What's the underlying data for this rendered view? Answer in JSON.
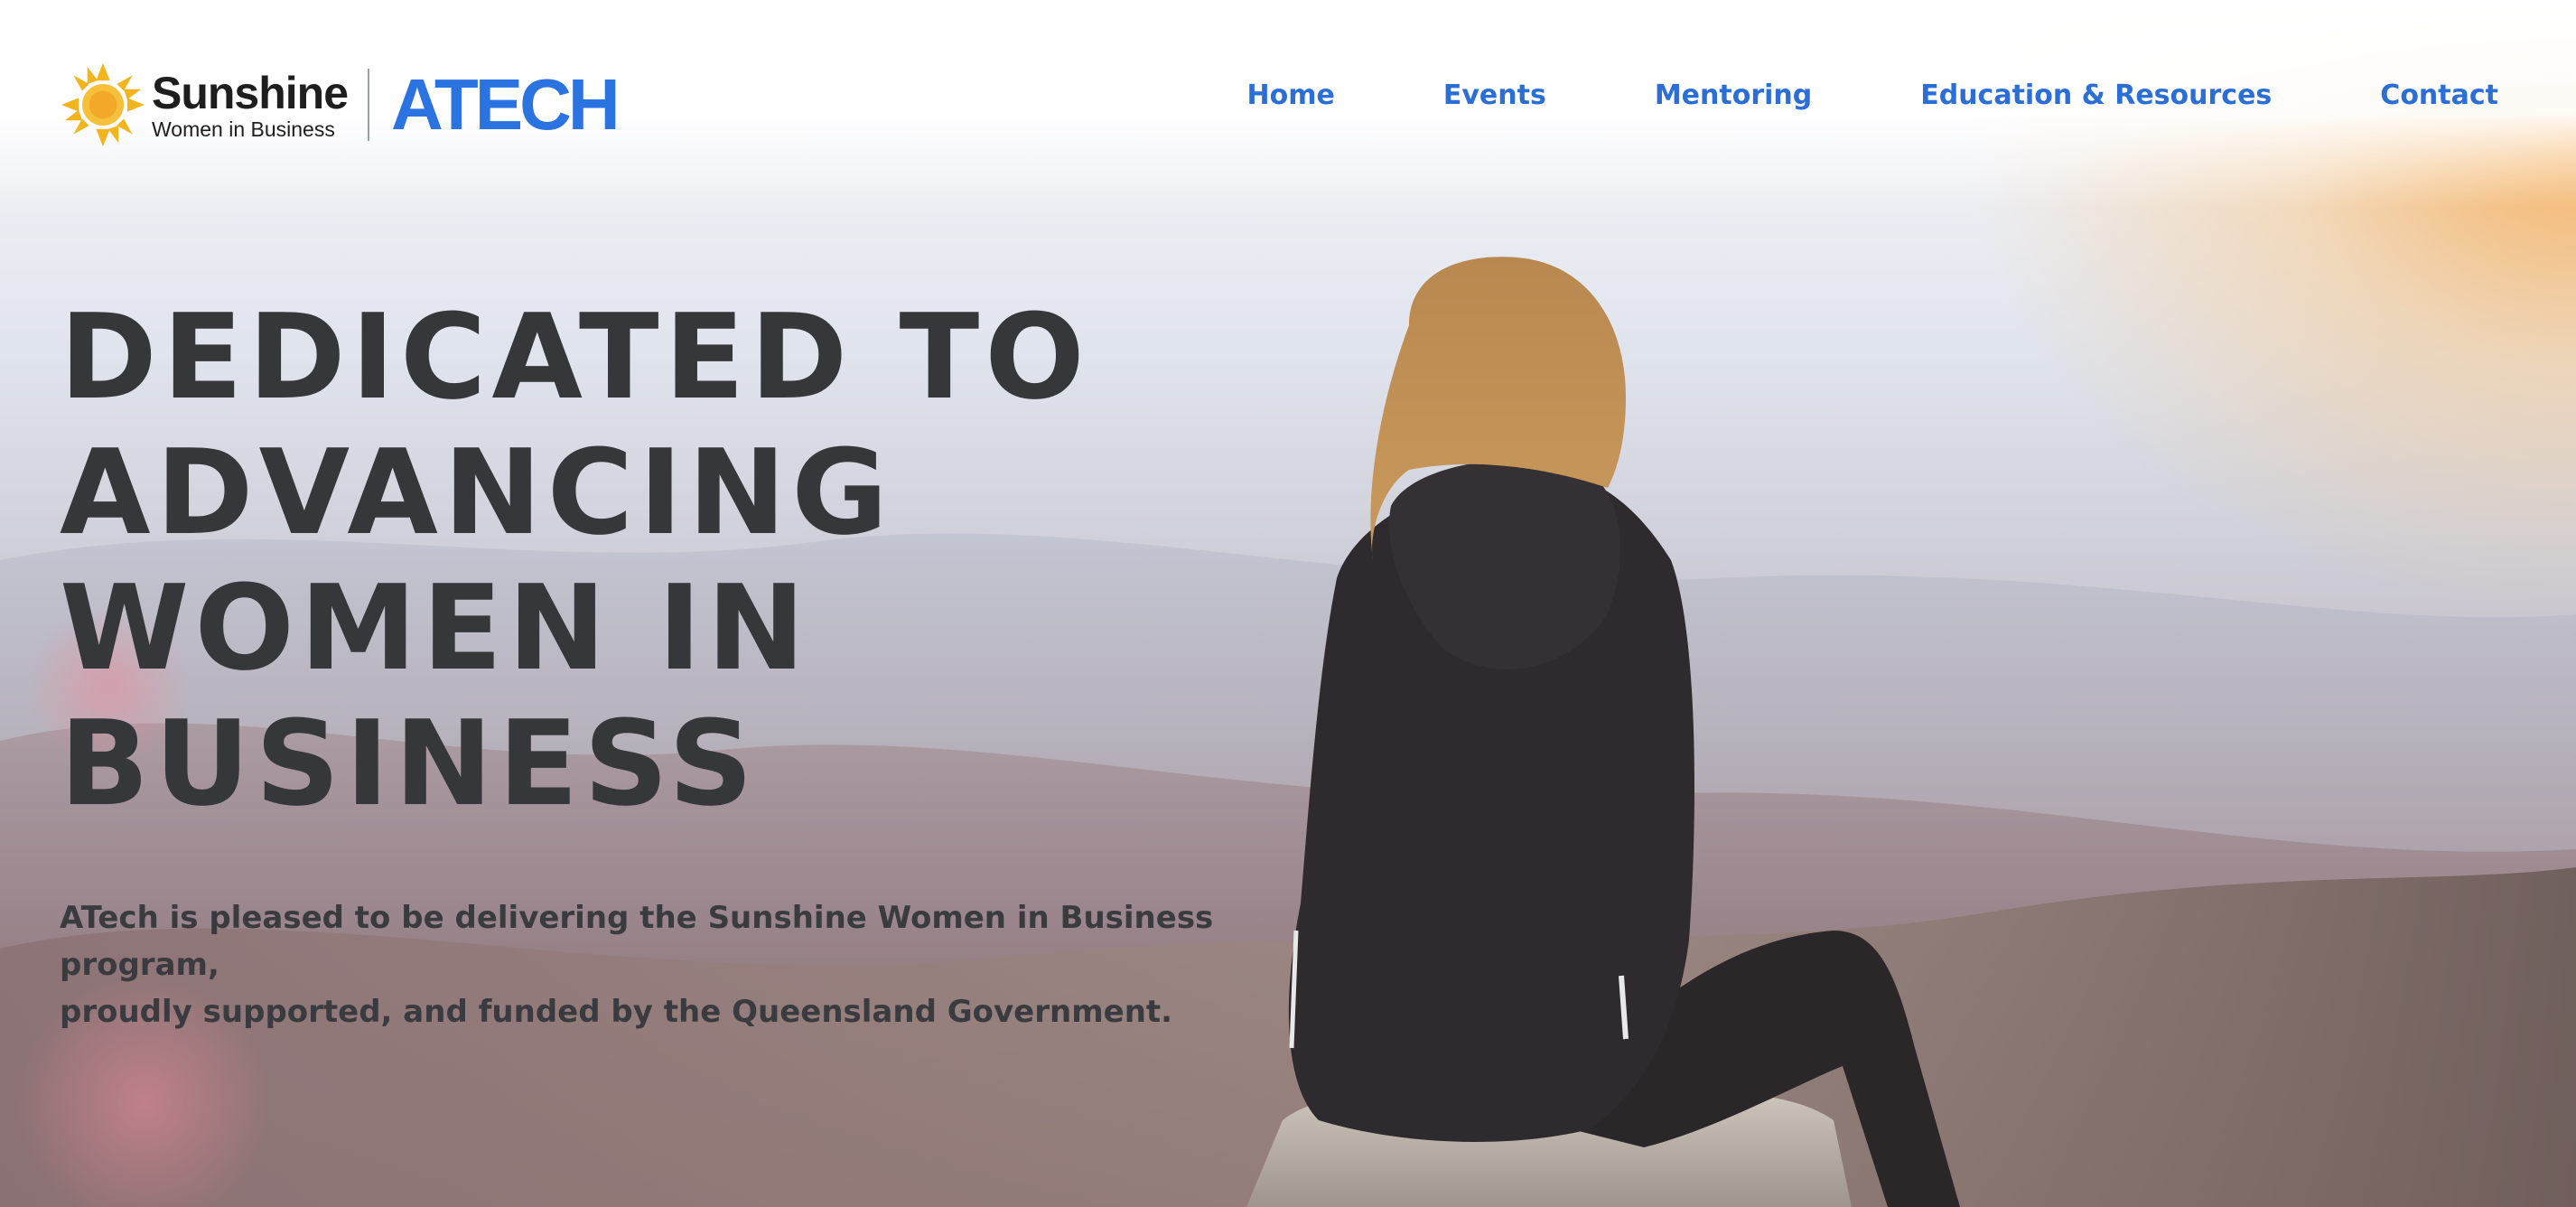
{
  "brand": {
    "name": "Sunshine",
    "tagline": "Women in Business",
    "partner": "ATECH"
  },
  "nav": {
    "items": [
      {
        "label": "Home"
      },
      {
        "label": "Events"
      },
      {
        "label": "Mentoring"
      },
      {
        "label": "Education & Resources"
      },
      {
        "label": "Contact"
      }
    ]
  },
  "hero": {
    "headline_lines": [
      "DEDICATED TO",
      "ADVANCING",
      "WOMEN IN",
      "BUSINESS"
    ],
    "subtitle_line1": "ATech is pleased to be delivering the Sunshine Women in Business program,",
    "subtitle_line2": "proudly supported, and funded by the Queensland Government."
  },
  "colors": {
    "accent": "#2b6fd6",
    "atech_blue": "#2a73e0",
    "headline": "#35373a",
    "sun": "#f2b51d"
  },
  "icons": {
    "logo": "sun-icon"
  }
}
